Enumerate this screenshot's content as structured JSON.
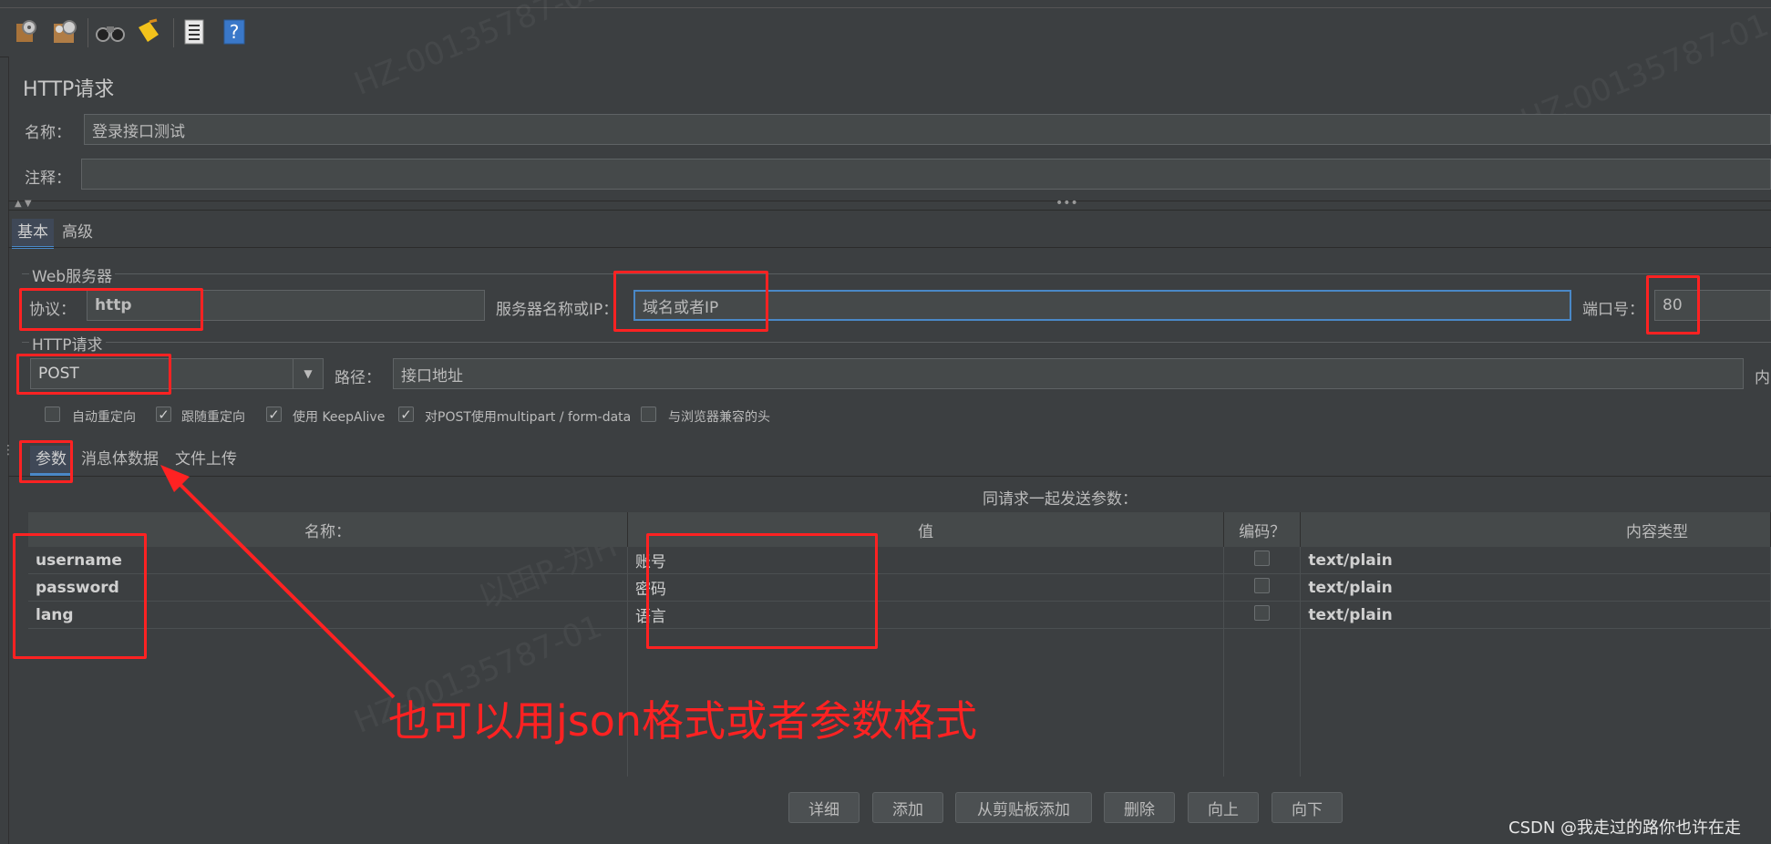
{
  "toolbar": {
    "icons": [
      "gear-icon",
      "gear-pack-icon",
      "binoculars-icon",
      "broom-icon",
      "list-icon",
      "help-icon"
    ]
  },
  "page_title": "HTTP请求",
  "name_field": {
    "label": "名称：",
    "value": "登录接口测试"
  },
  "comment_field": {
    "label": "注释：",
    "value": ""
  },
  "main_tabs": [
    "基本",
    "高级"
  ],
  "web_server": {
    "group_title": "Web服务器",
    "protocol_label": "协议：",
    "protocol_value": "http",
    "server_label": "服务器名称或IP：",
    "server_value": "域名或者IP",
    "port_label": "端口号：",
    "port_value": "80"
  },
  "http_request": {
    "group_title": "HTTP请求",
    "method": "POST",
    "path_label": "路径：",
    "path_value": "接口地址",
    "content_encoding_partial": "内"
  },
  "options": [
    {
      "label": "自动重定向",
      "checked": false
    },
    {
      "label": "跟随重定向",
      "checked": true
    },
    {
      "label": "使用 KeepAlive",
      "checked": true
    },
    {
      "label": "对POST使用multipart / form-data",
      "checked": true
    },
    {
      "label": "与浏览器兼容的头",
      "checked": false
    }
  ],
  "sub_tabs": [
    "参数",
    "消息体数据",
    "文件上传"
  ],
  "params_caption": "同请求一起发送参数：",
  "params_table": {
    "columns": [
      "名称：",
      "值",
      "编码？",
      "内容类型"
    ],
    "rows": [
      {
        "name": "username",
        "value": "账号",
        "encode": false,
        "content_type": "text/plain"
      },
      {
        "name": "password",
        "value": "密码",
        "encode": false,
        "content_type": "text/plain"
      },
      {
        "name": "lang",
        "value": "语言",
        "encode": false,
        "content_type": "text/plain"
      }
    ]
  },
  "annotation": "也可以用json格式或者参数格式",
  "buttons": [
    "详细",
    "添加",
    "从剪贴板添加",
    "删除",
    "向上",
    "向下"
  ],
  "footer_credit": "CSDN @我走过的路你也许在走",
  "watermarks": [
    "HZ-00135787-01",
    "HZ-00135787-01",
    "以田P-为H",
    "HZ-00135787-01"
  ],
  "colors": {
    "annotation_red": "#ff2222",
    "background": "#3c3f41",
    "field": "#45494a"
  }
}
